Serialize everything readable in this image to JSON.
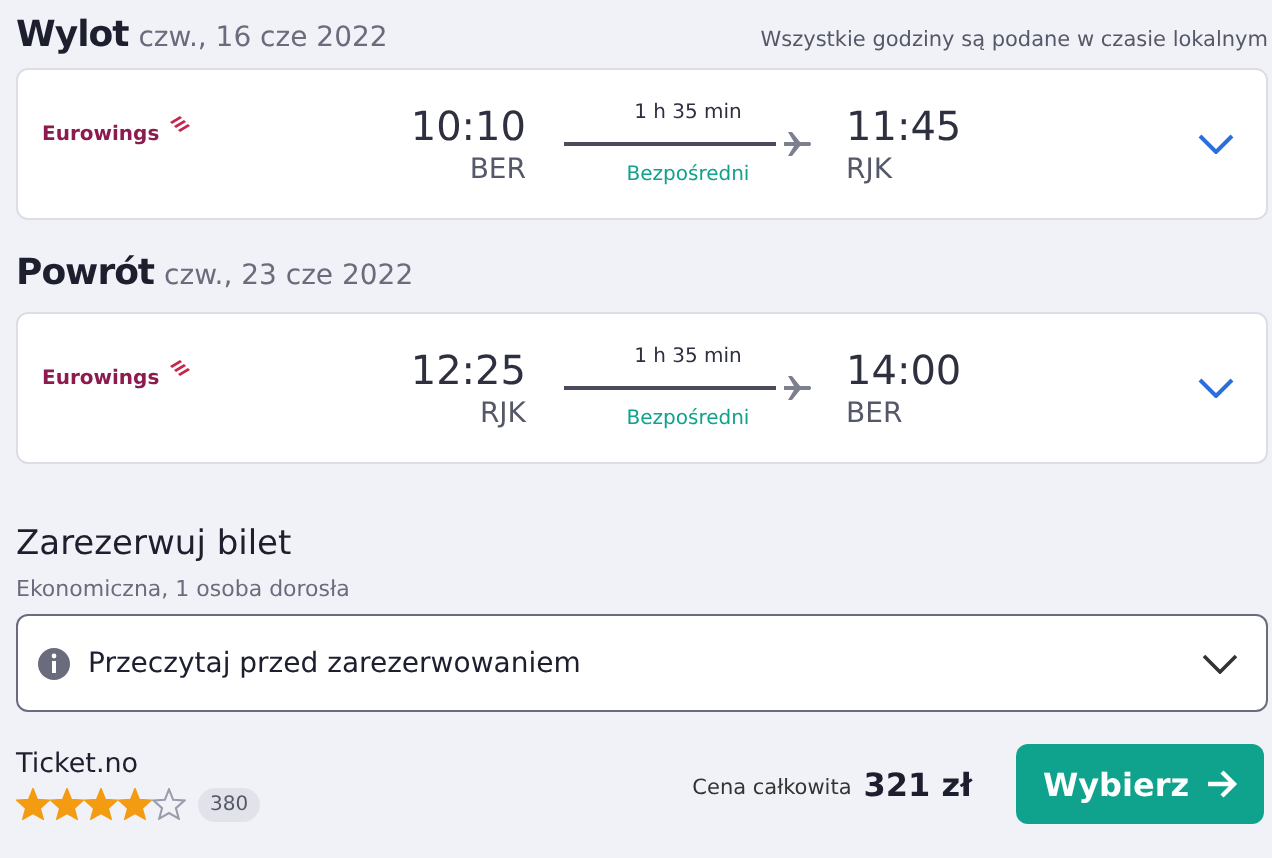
{
  "legs": [
    {
      "title": "Wylot",
      "date": "czw., 16 cze 2022",
      "note": "Wszystkie godziny są podane w czasie lokalnym",
      "airline": "Eurowings",
      "depart_time": "10:10",
      "depart_code": "BER",
      "duration": "1 h 35 min",
      "stops": "Bezpośredni",
      "arrive_time": "11:45",
      "arrive_code": "RJK",
      "expanded": false
    },
    {
      "title": "Powrót",
      "date": "czw., 23 cze 2022",
      "airline": "Eurowings",
      "depart_time": "12:25",
      "depart_code": "RJK",
      "duration": "1 h 35 min",
      "stops": "Bezpośredni",
      "arrive_time": "14:00",
      "arrive_code": "BER",
      "expanded": false
    }
  ],
  "booking": {
    "title": "Zarezerwuj bilet",
    "subtitle": "Ekonomiczna, 1 osoba dorosła",
    "notice": {
      "label": "Przeczytaj przed zarezerwowaniem",
      "expanded": false
    },
    "provider": "Ticket.no",
    "stars": 4,
    "reviews": "380",
    "price_label": "Cena całkowita",
    "price": "321 zł",
    "button": "Wybierz"
  }
}
